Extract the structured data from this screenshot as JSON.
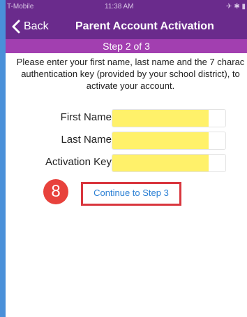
{
  "status_bar": {
    "carrier": "T-Mobile",
    "time": "11:38 AM",
    "right_icons": "✈ ✱ ▮"
  },
  "nav": {
    "back_label": "Back",
    "title": "Parent Account Activation"
  },
  "step": {
    "label": "Step 2 of 3"
  },
  "instructions": {
    "line1": "Please enter your first name, last name and the 7 charac",
    "line2": "authentication key (provided by your school district), to",
    "line3": "activate your account."
  },
  "form": {
    "first_name_label": "First Name",
    "first_name_value": "",
    "last_name_label": "Last Name",
    "last_name_value": "",
    "activation_key_label": "Activation Key",
    "activation_key_value": ""
  },
  "annotation": {
    "badge_number": "8"
  },
  "continue_label": "Continue to Step 3",
  "colors": {
    "nav_purple": "#6a2b8c",
    "step_purple": "#a23fb0",
    "highlight_yellow": "#fff16a",
    "badge_red": "#e8423c",
    "link_blue": "#2a7fd4"
  }
}
